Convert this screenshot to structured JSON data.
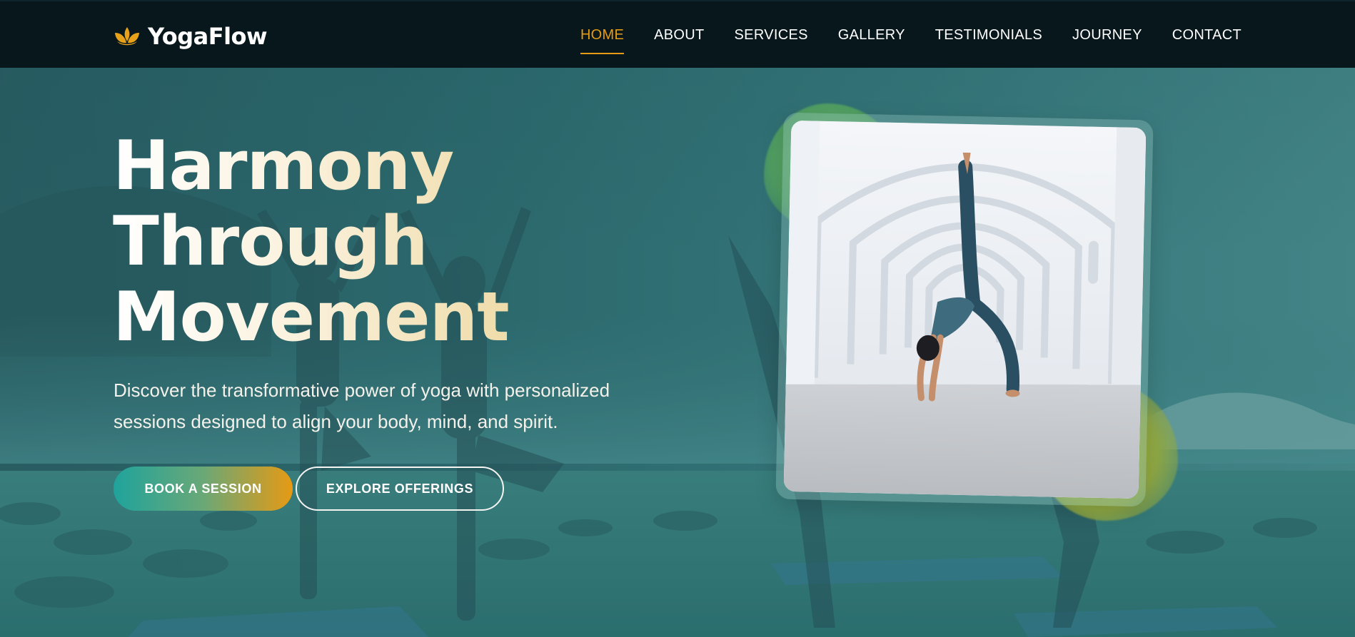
{
  "brand": {
    "name": "YogaFlow",
    "icon": "lotus-icon",
    "icon_color": "#e8a21a"
  },
  "nav": {
    "items": [
      {
        "label": "HOME",
        "active": true
      },
      {
        "label": "ABOUT",
        "active": false
      },
      {
        "label": "SERVICES",
        "active": false
      },
      {
        "label": "GALLERY",
        "active": false
      },
      {
        "label": "TESTIMONIALS",
        "active": false
      },
      {
        "label": "JOURNEY",
        "active": false
      },
      {
        "label": "CONTACT",
        "active": false
      }
    ],
    "active_color": "#e79b14"
  },
  "hero": {
    "title_lines": [
      "Harmony",
      "Through",
      "Movement"
    ],
    "subtitle": "Discover the transformative power of yoga with personalized sessions designed to align your body, mind, and spirit.",
    "primary_button": "BOOK A SESSION",
    "secondary_button": "EXPLORE OFFERINGS"
  },
  "colors": {
    "nav_background": "#08171c",
    "accent": "#e79b14",
    "teal": "#1fa39c"
  }
}
